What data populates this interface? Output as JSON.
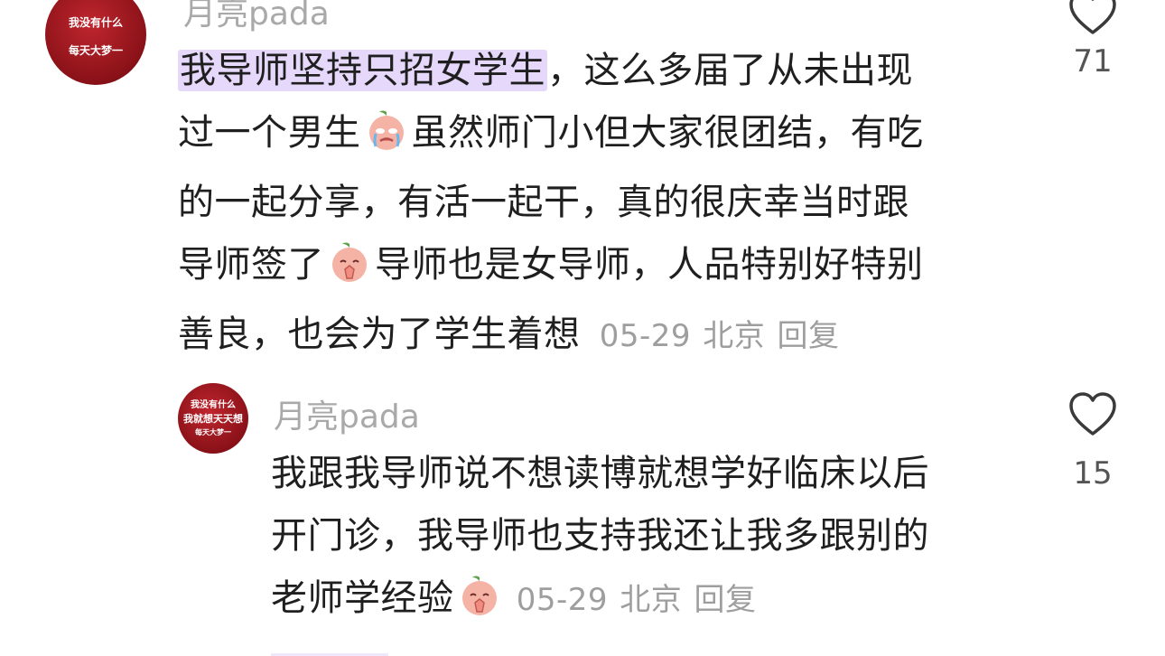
{
  "comments": [
    {
      "username": "月亮pada",
      "avatar_lines": [
        "我没有什么",
        "",
        "每天大梦一"
      ],
      "text": {
        "highlight": "我导师坚持只招女学生",
        "lines": [
          "，这么多届了从未出现",
          "过一个男生",
          "虽然师门小但大家很团结，有吃",
          "的一起分享，有活一起干，真的很庆幸当时跟",
          "导师签了",
          "导师也是女导师，人品特别好特别",
          "善良，也会为了学生着想"
        ]
      },
      "date": "05-29",
      "location": "北京",
      "reply_label": "回复",
      "likes": "71"
    },
    {
      "username": "月亮pada",
      "avatar_lines": [
        "我没有什么",
        "我就想天天想",
        "每天大梦一"
      ],
      "text": {
        "lines": [
          "我跟我导师说不想读博就想学好临床以后",
          "开门诊，我导师也支持我还让我多跟别的",
          "老师学经验"
        ]
      },
      "date": "05-29",
      "location": "北京",
      "reply_label": "回复",
      "likes": "15"
    }
  ],
  "icons": {
    "like": "heart-outline-icon",
    "emoji_crying": "crying-peach-emoji-icon",
    "emoji_pray": "praying-peach-emoji-icon"
  },
  "colors": {
    "highlight": "#e6d8fb",
    "username": "#a9a9a9",
    "meta": "#9e9e9e",
    "avatar": "#a3141c"
  }
}
